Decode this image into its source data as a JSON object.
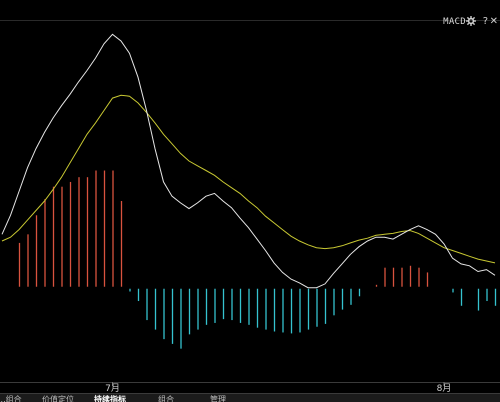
{
  "panel": {
    "title": "MACD",
    "icons": [
      "gear-icon",
      "help-icon",
      "close-icon"
    ],
    "help_glyph": "?",
    "close_glyph": "✕"
  },
  "colors": {
    "background": "#000000",
    "dif_line": "#e6e6e6",
    "dea_line": "#c8c832",
    "positive_bar": "#d9533f",
    "negative_bar": "#35c3cf",
    "grid": "#2a2a2a"
  },
  "tabs": [
    "...组合",
    "价值定位",
    "持续指标",
    "组合",
    "管理"
  ],
  "chart_data": {
    "type": "line",
    "x_tick_labels": [
      {
        "index": 13,
        "label": "7月"
      },
      {
        "index": 52,
        "label": "8月"
      }
    ],
    "ylim": [
      -1.0,
      2.8
    ],
    "zero_line": 0,
    "series": [
      {
        "values": [
          0.55,
          0.75,
          1.0,
          1.25,
          1.45,
          1.62,
          1.77,
          1.9,
          2.02,
          2.15,
          2.27,
          2.4,
          2.55,
          2.65,
          2.58,
          2.45,
          2.2,
          1.85,
          1.45,
          1.1,
          0.95,
          0.88,
          0.82,
          0.88,
          0.95,
          0.98,
          0.9,
          0.83,
          0.72,
          0.62,
          0.5,
          0.38,
          0.25,
          0.15,
          0.08,
          0.04,
          -0.01,
          -0.01,
          0.03,
          0.14,
          0.24,
          0.34,
          0.42,
          0.48,
          0.52,
          0.52,
          0.5,
          0.55,
          0.6,
          0.64,
          0.6,
          0.55,
          0.45,
          0.3,
          0.24,
          0.22,
          0.16,
          0.18,
          0.12
        ]
      },
      {
        "values": [
          0.48,
          0.52,
          0.6,
          0.7,
          0.8,
          0.9,
          1.02,
          1.15,
          1.3,
          1.45,
          1.6,
          1.72,
          1.85,
          1.98,
          2.01,
          2.0,
          1.93,
          1.83,
          1.72,
          1.6,
          1.5,
          1.4,
          1.32,
          1.27,
          1.22,
          1.17,
          1.1,
          1.04,
          0.98,
          0.9,
          0.83,
          0.74,
          0.67,
          0.6,
          0.53,
          0.48,
          0.44,
          0.41,
          0.4,
          0.41,
          0.43,
          0.46,
          0.49,
          0.51,
          0.54,
          0.55,
          0.56,
          0.58,
          0.59,
          0.56,
          0.51,
          0.46,
          0.41,
          0.38,
          0.35,
          0.32,
          0.29,
          0.27,
          0.25
        ]
      }
    ],
    "histogram": [
      0.0,
      0.0,
      0.46,
      0.55,
      0.75,
      0.92,
      1.05,
      1.05,
      1.1,
      1.15,
      1.15,
      1.22,
      1.22,
      1.22,
      0.9,
      -0.05,
      -0.15,
      -0.35,
      -0.45,
      -0.55,
      -0.6,
      -0.65,
      -0.5,
      -0.45,
      -0.4,
      -0.38,
      -0.34,
      -0.35,
      -0.38,
      -0.4,
      -0.43,
      -0.45,
      -0.47,
      -0.48,
      -0.49,
      -0.48,
      -0.45,
      -0.42,
      -0.39,
      -0.3,
      -0.24,
      -0.19,
      -0.1,
      0.0,
      0.02,
      0.2,
      0.2,
      0.2,
      0.22,
      0.2,
      0.15,
      0.0,
      0.0,
      -0.06,
      -0.2,
      0.0,
      -0.25,
      -0.15,
      -0.2
    ],
    "grid": false,
    "legend": "none"
  }
}
